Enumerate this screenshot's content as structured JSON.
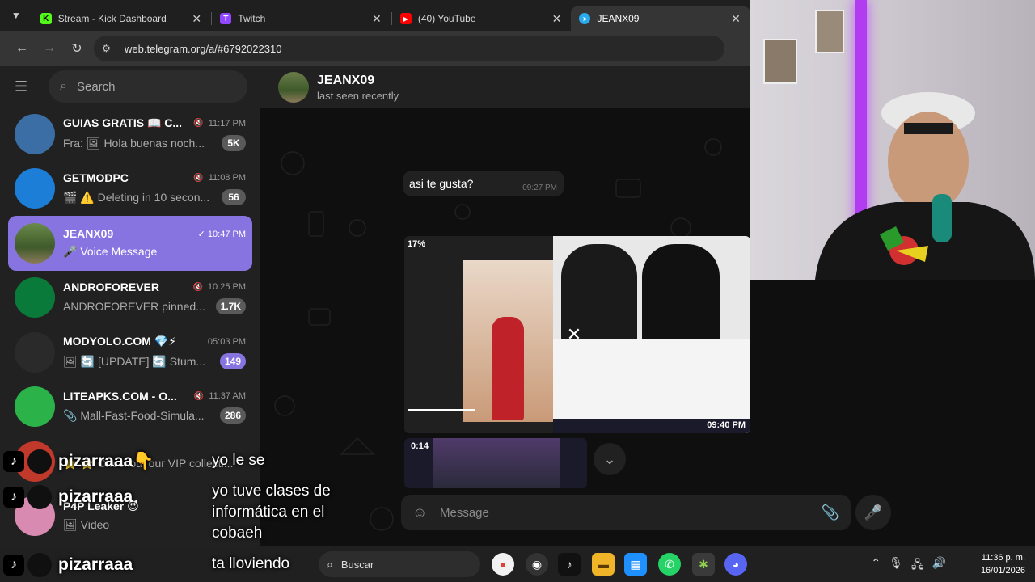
{
  "browser": {
    "tabs": [
      {
        "label": "Stream - Kick Dashboard",
        "icon": "kick-icon",
        "color": "#53fc18",
        "glyph": "K"
      },
      {
        "label": "Twitch",
        "icon": "twitch-icon",
        "color": "#9146ff",
        "glyph": "T"
      },
      {
        "label": "(40) YouTube",
        "icon": "youtube-icon",
        "color": "#ff0000",
        "glyph": "▶"
      },
      {
        "label": "JEANX09",
        "icon": "telegram-icon",
        "color": "#2aabee",
        "glyph": "➤"
      }
    ],
    "url": "web.telegram.org/a/#6792022310"
  },
  "sidebar": {
    "search_placeholder": "Search",
    "chats": [
      {
        "name": "GUIAS GRATIS 📖 C...",
        "muted": true,
        "time": "11:17 PM",
        "preview": "Fra: 🖼 Hola buenas noch...",
        "badge": "5K",
        "avatar_color": "#3a6ea5"
      },
      {
        "name": "GETMODPC",
        "muted": true,
        "time": "11:08 PM",
        "preview": "🎬 ⚠️ Deleting in 10 secon...",
        "badge": "56",
        "avatar_color": "#1c7ed6"
      },
      {
        "name": "JEANX09",
        "muted": false,
        "time": "✓ 10:47 PM",
        "preview": "🎤 Voice Message",
        "badge": "",
        "avatar_color": "#4a6a2a"
      },
      {
        "name": "ANDROFOREVER",
        "muted": true,
        "time": "10:25 PM",
        "preview": "ANDROFOREVER pinned...",
        "badge": "1.7K",
        "avatar_color": "#0a7a3a"
      },
      {
        "name": "MODYOLO.COM 💎⚡",
        "muted": false,
        "time": "05:03 PM",
        "preview": "🖼 🔄 [UPDATE] 🔄 Stum...",
        "badge": "149",
        "avatar_color": "#2a2a2a"
      },
      {
        "name": "LITEAPKS.COM - O...",
        "muted": true,
        "time": "11:37 AM",
        "preview": "📎 Mall-Fast-Food-Simula...",
        "badge": "286",
        "avatar_color": "#2bb34a"
      },
      {
        "name": "",
        "muted": false,
        "time": "",
        "preview": "⭐ ⭐ Checkout our VIP collecti...",
        "badge": "",
        "avatar_color": "#c0392b"
      },
      {
        "name": "P4P Leaker 😈",
        "muted": false,
        "time": "",
        "preview": "🖼 Video",
        "badge": "",
        "avatar_color": "#d98ab0"
      }
    ]
  },
  "chat": {
    "name": "JEANX09",
    "status": "last seen recently",
    "bubble_text": "asi te gusta?",
    "bubble_time": "09:27 PM",
    "media_duration": "17%",
    "media_time": "09:40 PM",
    "media2_duration": "0:14",
    "composer_placeholder": "Message"
  },
  "overlay_chat": [
    {
      "user": "pizarraaa👇",
      "message": "yo le se"
    },
    {
      "user": "pizarraaa",
      "message": "yo tuve clases de informática en el cobaeh"
    },
    {
      "user": "pizarraaa",
      "message": "ta lloviendo"
    }
  ],
  "taskbar": {
    "search_label": "Buscar",
    "time": "11:36 p. m.",
    "date": "16/01/2026"
  }
}
